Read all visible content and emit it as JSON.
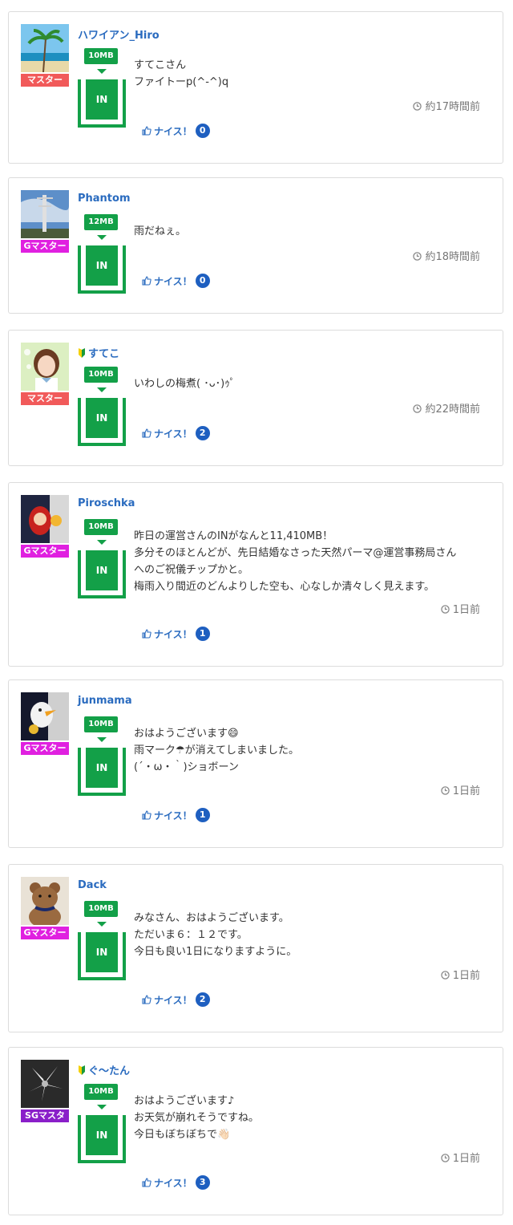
{
  "posts": [
    {
      "username": "ハワイアン_Hiro",
      "beginner": false,
      "rank": "マスター",
      "rank_color": "#f15a5a",
      "avatar": "beach-avatar",
      "data_mb": "10MB",
      "in_label": "IN",
      "message_lines": [
        "すてこさん",
        "ファイトーp(^-^)q"
      ],
      "time": "約17時間前",
      "nice_label": "ナイス！",
      "nice_count": "0"
    },
    {
      "username": "Phantom",
      "beginner": false,
      "rank": "Gマスター",
      "rank_color": "#e020e0",
      "avatar": "tower-avatar",
      "data_mb": "12MB",
      "in_label": "IN",
      "message_lines": [
        "雨だねぇ。"
      ],
      "time": "約18時間前",
      "nice_label": "ナイス！",
      "nice_count": "0"
    },
    {
      "username": "すてこ",
      "beginner": true,
      "rank": "マスター",
      "rank_color": "#f15a5a",
      "avatar": "girl-avatar",
      "data_mb": "10MB",
      "in_label": "IN",
      "message_lines": [
        "いわしの梅煮( ･ᴗ･)ｩﾟ"
      ],
      "time": "約22時間前",
      "nice_label": "ナイス！",
      "nice_count": "2"
    },
    {
      "username": "Piroschka",
      "beginner": false,
      "rank": "Gマスター",
      "rank_color": "#e020e0",
      "avatar": "doll-avatar",
      "data_mb": "10MB",
      "in_label": "IN",
      "message_lines": [
        "昨日の運営さんのINがなんと11,410MB！",
        "多分そのほとんどが、先日結婚なさった天然パーマ@運営事務局さん",
        "へのご祝儀チップかと。",
        "梅雨入り間近のどんよりした空も、心なしか清々しく見えます。"
      ],
      "time": "1日前",
      "nice_label": "ナイス！",
      "nice_count": "1"
    },
    {
      "username": "junmama",
      "beginner": false,
      "rank": "Gマスター",
      "rank_color": "#e020e0",
      "avatar": "bird-avatar",
      "data_mb": "10MB",
      "in_label": "IN",
      "message_lines": [
        "おはようございます😄",
        "雨マーク☂が消えてしまいました。",
        "(´・ω・｀)ショボーン"
      ],
      "time": "1日前",
      "nice_label": "ナイス！",
      "nice_count": "1"
    },
    {
      "username": "Dack",
      "beginner": false,
      "rank": "Gマスター",
      "rank_color": "#e020e0",
      "avatar": "teddy-avatar",
      "data_mb": "10MB",
      "in_label": "IN",
      "message_lines": [
        "みなさん、おはようございます。",
        "ただいま６：１２です。",
        "今日も良い1日になりますように。"
      ],
      "time": "1日前",
      "nice_label": "ナイス！",
      "nice_count": "2"
    },
    {
      "username": "ぐ〜たん",
      "beginner": true,
      "rank": "SGマスタ",
      "rank_color": "#8a1fc9",
      "avatar": "lily-avatar",
      "data_mb": "10MB",
      "in_label": "IN",
      "message_lines": [
        "おはようございます♪",
        "お天気が崩れそうですね。",
        "今日もぼちぼちで👋🏻"
      ],
      "time": "1日前",
      "nice_label": "ナイス！",
      "nice_count": "3"
    }
  ]
}
